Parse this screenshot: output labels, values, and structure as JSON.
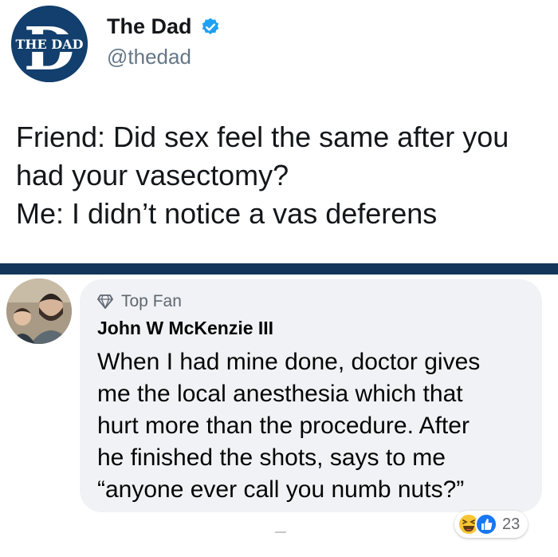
{
  "tweet": {
    "logo_text": "THE DAD",
    "logo_letter": "D",
    "display_name": "The Dad",
    "handle": "@thedad",
    "verified": true,
    "lines": [
      "Friend: Did sex feel the same after you",
      "had your vasectomy?",
      "Me: I didn’t notice a vas deferens"
    ]
  },
  "comment": {
    "badge": "Top Fan",
    "badge_icon": "diamond-icon",
    "author": "John W McKenzie III",
    "lines": [
      "When I had mine done, doctor gives",
      "me the local anesthesia which that",
      "hurt more than the procedure.  After",
      "he finished the shots, says to me",
      "“anyone ever call you numb nuts?”"
    ],
    "reactions": {
      "icons": [
        "haha-icon",
        "like-icon"
      ],
      "count": "23"
    }
  },
  "colors": {
    "divider": "#13365a",
    "logo_bg": "#123f6d",
    "verified": "#1da1f2",
    "bubble_bg": "#f0f2f5",
    "like_blue": "#1877f2",
    "haha_yellow": "#f7c533"
  }
}
